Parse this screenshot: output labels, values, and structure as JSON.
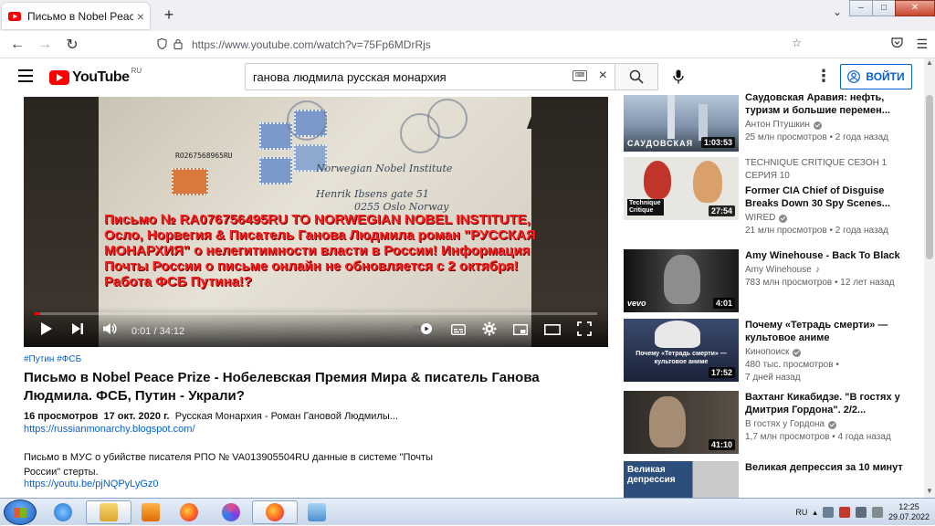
{
  "browser": {
    "tab_title": "Письмо в Nobel Peace Prize - Н",
    "tab_close": "×",
    "new_tab": "+",
    "url": "https://www.youtube.com/watch?v=75Fp6MDrRjs",
    "window_controls": {
      "minimize": "–",
      "maximize": "□",
      "close": "✕"
    }
  },
  "header": {
    "logo_text": "YouTube",
    "logo_region": "RU",
    "search_value": "ганова людмила русская монархия",
    "search_clear": "×",
    "signin_label": "ВОЙТИ",
    "more_label": "⋮"
  },
  "player": {
    "overlay_text": "Письмо № RA076756495RU TO NORWEGIAN NOBEL INSTITUTE, Осло, Норвегия & Писатель Ганова Людмила роман \"РУССКАЯ МОНАРХИЯ\" о нелегитимности власти в России! Информация Почты России о письме онлайн не обновляется с 2 октября! Работа ФСБ Путина!?",
    "time": "0:01 / 34:12",
    "progress": 0.0005,
    "envelope_barcode": "RO267568965RU",
    "envelope_lines": [
      "Norwegian Nobel Institute",
      "Henrik Ibsens gate 51",
      "0255 Oslo Norway"
    ],
    "envelope_letter": "A"
  },
  "video": {
    "hashtags": "#Путин #ФСБ",
    "title": "Письмо в Nobel Peace Prize - Нобелевская Премия Мира & писатель Ганова Людмила. ФСБ, Путин - Украли?",
    "views": "16 просмотров",
    "date": "17 окт. 2020 г.",
    "desc_first": "Русская Монархия - Роман Гановой Людмилы...",
    "link1": "https://russianmonarchy.blogspot.com/",
    "desc_body": "Письмо в МУС о убийстве писателя РПО № VA013905504RU данные в системе \"Почты России\" стерты.",
    "link2": "https://youtu.be/pjNQPyLyGz0"
  },
  "recommendations": [
    {
      "title": "Саудовская Аравия: нефть, туризм и большие перемен...",
      "channel": "Антон Птушкин",
      "verified": true,
      "meta": "25 млн просмотров • 2 года назад",
      "duration": "1:03:53",
      "thumb_label": "САУДОВСКАЯ"
    },
    {
      "tag": "TECHNIQUE CRITIQUE  СЕЗОН 1 СЕРИЯ 10",
      "title": "Former CIA Chief of Disguise Breaks Down 30 Spy Scenes...",
      "channel": "WIRED",
      "verified": true,
      "meta": "21 млн просмотров • 2 года назад",
      "duration": "27:54",
      "thumb_label": "Technique Critique"
    },
    {
      "title": "Amy Winehouse - Back To Black",
      "channel": "Amy Winehouse",
      "music": true,
      "meta": "783 млн просмотров • 12 лет назад",
      "duration": "4:01",
      "thumb_label": "vevo"
    },
    {
      "title": "Почему «Тетрадь смерти» — культовое аниме",
      "channel": "Кинопоиск",
      "verified": true,
      "meta": "480 тыс. просмотров •",
      "meta2": "7 дней назад",
      "duration": "17:52",
      "thumb_label": "Почему «Тетрадь смерти» — культовое аниме"
    },
    {
      "title": "Вахтанг Кикабидзе. \"В гостях у Дмитрия Гордона\". 2/2...",
      "channel": "В гостях у Гордона",
      "verified": true,
      "meta": "1,7 млн просмотров • 4 года назад",
      "duration": "41:10",
      "thumb_label": ""
    },
    {
      "title": "Великая депрессия за 10 минут",
      "channel": "",
      "meta": "",
      "duration": "",
      "thumb_label": "Великая депрессия"
    }
  ],
  "taskbar": {
    "lang": "RU",
    "time": "12:25",
    "date": "29.07.2022"
  },
  "colors": {
    "yt_red": "#ff0000",
    "link_blue": "#065fd4",
    "overlay_red": "#ff1e1e"
  }
}
